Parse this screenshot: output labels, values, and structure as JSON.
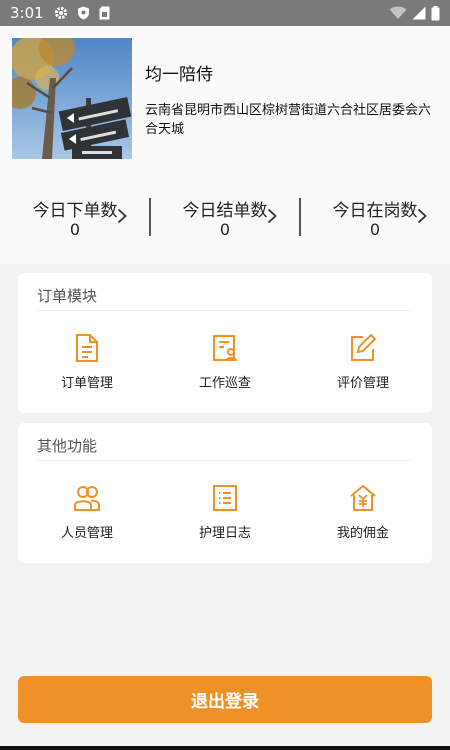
{
  "status_bar": {
    "time": "3:01",
    "icons": [
      "gear-icon",
      "shield-icon",
      "sim-icon"
    ],
    "right_icons": [
      "wifi-icon",
      "signal-icon",
      "battery-icon"
    ]
  },
  "profile": {
    "name": "均一陪侍",
    "address": "云南省昆明市西山区棕树营街道六合社区居委会六合天城"
  },
  "stats": [
    {
      "label": "今日下单数",
      "value": "0"
    },
    {
      "label": "今日结单数",
      "value": "0"
    },
    {
      "label": "今日在岗数",
      "value": "0"
    }
  ],
  "order_module": {
    "title": "订单模块",
    "items": [
      {
        "label": "订单管理",
        "icon": "document-icon"
      },
      {
        "label": "工作巡查",
        "icon": "inspection-icon"
      },
      {
        "label": "评价管理",
        "icon": "edit-icon"
      }
    ]
  },
  "other_module": {
    "title": "其他功能",
    "items": [
      {
        "label": "人员管理",
        "icon": "people-icon"
      },
      {
        "label": "护理日志",
        "icon": "list-icon"
      },
      {
        "label": "我的佣金",
        "icon": "commission-icon"
      }
    ]
  },
  "logout_label": "退出登录",
  "colors": {
    "accent": "#ef9126",
    "status_bar": "#7a7a7a",
    "background": "#f2f2f2"
  }
}
